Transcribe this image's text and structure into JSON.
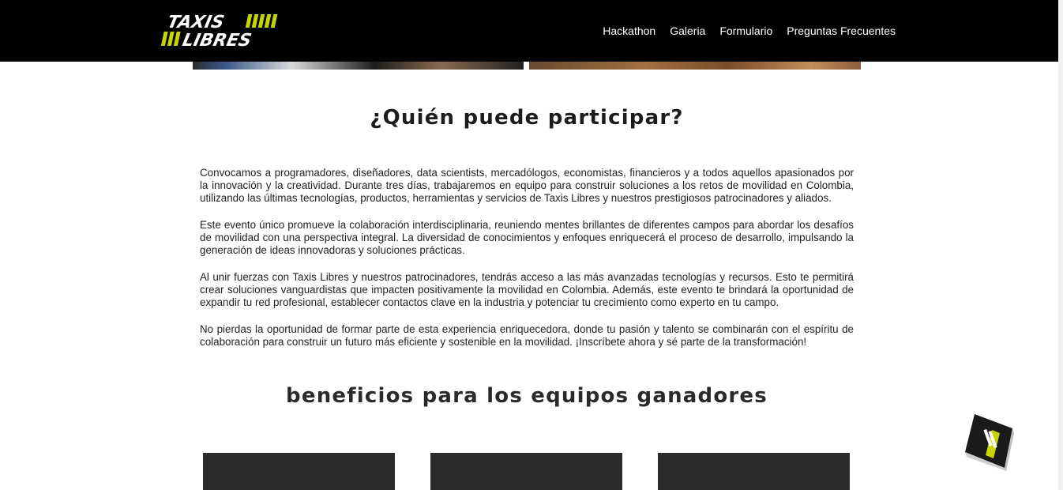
{
  "header": {
    "logo_line1": "TAXIS",
    "logo_line2": "LIBRES",
    "accent_color": "#c8d400",
    "nav": [
      {
        "label": "Hackathon"
      },
      {
        "label": "Galeria"
      },
      {
        "label": "Formulario"
      },
      {
        "label": "Preguntas Frecuentes"
      }
    ]
  },
  "section_participar": {
    "title": "¿Quién puede participar?",
    "paragraphs": [
      "Convocamos a programadores, diseñadores, data scientists, mercadólogos, economistas, financieros y a todos aquellos apasionados por la innovación y la creatividad. Durante tres días, trabajaremos en equipo para construir soluciones a los retos de movilidad en Colombia, utilizando las últimas tecnologías, productos, herramientas y servicios de Taxis Libres y nuestros prestigiosos patrocinadores y aliados.",
      "Este evento único promueve la colaboración interdisciplinaria, reuniendo mentes brillantes de diferentes campos para abordar los desafíos de movilidad con una perspectiva integral. La diversidad de conocimientos y enfoques enriquecerá el proceso de desarrollo, impulsando la generación de ideas innovadoras y soluciones prácticas.",
      "Al unir fuerzas con Taxis Libres y nuestros patrocinadores, tendrás acceso a las más avanzadas tecnologías y recursos. Esto te permitirá crear soluciones vanguardistas que impacten positivamente la movilidad en Colombia. Además, este evento te brindará la oportunidad de expandir tu red profesional, establecer contactos clave en la industria y potenciar tu crecimiento como experto en tu campo.",
      "No pierdas la oportunidad de formar parte de esta experiencia enriquecedora, donde tu pasión y talento se combinarán con el espíritu de colaboración para construir un futuro más eficiente y sostenible en la movilidad. ¡Inscríbete ahora y sé parte de la transformación!"
    ]
  },
  "section_beneficios": {
    "title": "beneficios para los equipos ganadores"
  },
  "badge": {
    "icon": "taxis-libres-cube-icon"
  }
}
